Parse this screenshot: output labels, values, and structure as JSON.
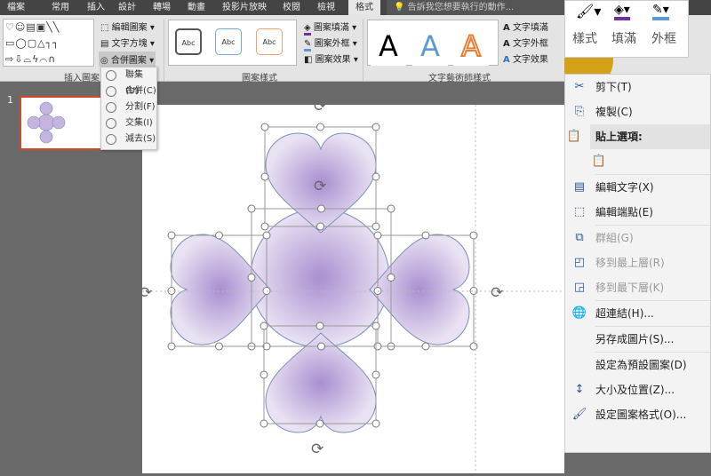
{
  "tabs": [
    "檔案",
    "常用",
    "插入",
    "設計",
    "轉場",
    "動畫",
    "投影片放映",
    "校閱",
    "檢視",
    "格式"
  ],
  "active_tab": "格式",
  "search_placeholder": "告訴我您想要執行的動作...",
  "ribbon": {
    "insert_shapes": {
      "label": "插入圖案",
      "edit_shape": "編輯圖案",
      "text_box": "文字方塊",
      "merge_shapes": "合併圖案"
    },
    "shape_styles": {
      "label": "圖案樣式",
      "abc": "Abc",
      "fill": "圖案填滿",
      "outline": "圖案外框",
      "effects": "圖案效果"
    },
    "wordart": {
      "label": "文字藝術師樣式",
      "letter": "A",
      "fill": "文字填滿",
      "outline": "文字外框",
      "effects": "文字效果"
    }
  },
  "merge_menu": [
    "聯集(U)",
    "合併(C)",
    "分割(F)",
    "交集(I)",
    "減去(S)"
  ],
  "slide_number": "1",
  "mini_toolbar": {
    "style": "樣式",
    "fill": "填滿",
    "outline": "外框",
    "colors": {
      "fill": "#7030a0",
      "outline": "#5b9bd5"
    }
  },
  "context_menu": [
    {
      "label": "剪下(T)",
      "icon": "scissors-icon"
    },
    {
      "label": "複製(C)",
      "icon": "copy-icon"
    },
    {
      "label": "貼上選項:",
      "icon": "paste-icon",
      "header": true
    },
    {
      "label": "",
      "icon": "paste-text-only-icon"
    },
    {
      "label": "編輯文字(X)",
      "icon": "edit-text-icon"
    },
    {
      "label": "編輯端點(E)",
      "icon": "edit-points-icon"
    },
    {
      "label": "群組(G)",
      "icon": "group-icon",
      "disabled": true
    },
    {
      "label": "移到最上層(R)",
      "icon": "bring-front-icon",
      "disabled": true
    },
    {
      "label": "移到最下層(K)",
      "icon": "send-back-icon",
      "disabled": true
    },
    {
      "label": "超連結(H)...",
      "icon": "hyperlink-icon"
    },
    {
      "label": "另存成圖片(S)...",
      "icon": ""
    },
    {
      "label": "設定為預設圖案(D)",
      "icon": ""
    },
    {
      "label": "大小及位置(Z)...",
      "icon": "size-position-icon"
    },
    {
      "label": "設定圖案格式(O)...",
      "icon": "format-shape-icon"
    }
  ],
  "colors": {
    "accent": "#d24726",
    "heart_fill": "#b9a4d6",
    "heart_stroke": "#7a8fb8"
  }
}
